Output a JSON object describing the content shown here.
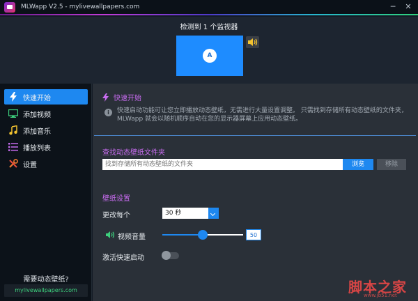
{
  "window": {
    "title": "MLWapp V2.5 - mylivewallpapers.com",
    "minimize": "─",
    "close": "✕"
  },
  "monitor": {
    "caption": "检测到 1 个监视器",
    "label": "A",
    "color": "#1e8cff"
  },
  "sidebar": {
    "items": [
      {
        "label": "快速开始",
        "icon": "lightning-icon",
        "active": true
      },
      {
        "label": "添加视频",
        "icon": "monitor-icon",
        "active": false
      },
      {
        "label": "添加音乐",
        "icon": "music-icon",
        "active": false
      },
      {
        "label": "播放列表",
        "icon": "list-icon",
        "active": false
      },
      {
        "label": "设置",
        "icon": "tools-icon",
        "active": false
      }
    ],
    "promo_text": "需要动态壁纸?",
    "promo_link": "mylivewallpapers.com"
  },
  "content": {
    "section_title": "快速开始",
    "info_text": "快速启动功能可让您立即播放动态壁纸，无需进行大量设置调整。 只需找到存储所有动态壁纸的文件夹，MLWapp 就会以随机顺序自动在您的显示器屏幕上应用动态壁纸。",
    "folder": {
      "heading": "查找动态壁纸文件夹",
      "placeholder": "找到存储所有动态壁纸的文件夹",
      "browse": "浏览",
      "remove": "移除"
    },
    "settings": {
      "heading": "壁纸设置",
      "change_every_label": "更改每个",
      "change_every_value": "30 秒",
      "volume_label": "视频音量",
      "volume_value": "50",
      "volume_fraction": 0.5,
      "quickstart_label": "激活快速启动",
      "quickstart_enabled": false
    }
  },
  "watermark": {
    "text": "脚本之家",
    "url": "www.jb51.net"
  },
  "colors": {
    "accent": "#1e88f0",
    "heading": "#c86cf0",
    "link": "#3dd07d"
  }
}
